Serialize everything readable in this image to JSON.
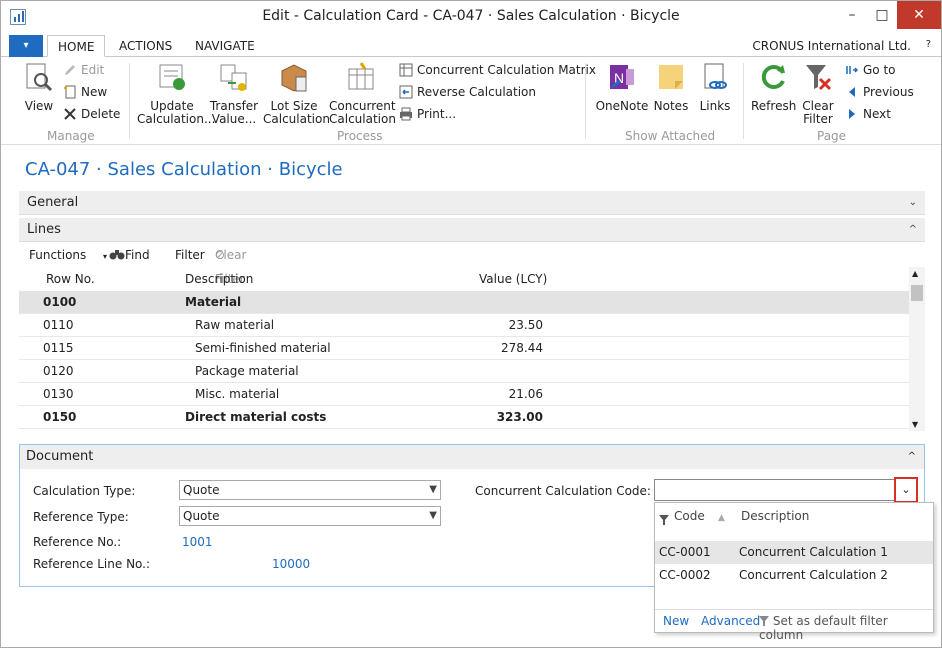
{
  "window": {
    "title": "Edit - Calculation Card - CA-047 · Sales Calculation · Bicycle",
    "minimize": "–",
    "maximize": "□",
    "close": "✕"
  },
  "ribbon_tabs": {
    "menu": "▾",
    "home": "HOME",
    "actions": "ACTIONS",
    "navigate": "NAVIGATE",
    "company": "CRONUS International Ltd.",
    "help": "?"
  },
  "ribbon": {
    "view": "View",
    "edit": "Edit",
    "new": "New",
    "delete": "Delete",
    "update_calculation": [
      "Update",
      "Calculation..."
    ],
    "transfer_value": [
      "Transfer",
      "Value..."
    ],
    "lot_size_calculation": [
      "Lot Size",
      "Calculation"
    ],
    "concurrent_calculation": [
      "Concurrent",
      "Calculation"
    ],
    "concurrent_calculation_matrix": "Concurrent Calculation Matrix",
    "reverse_calculation": "Reverse Calculation",
    "print": "Print...",
    "onenote": "OneNote",
    "notes": "Notes",
    "links": "Links",
    "refresh": "Refresh",
    "clear_filter": [
      "Clear",
      "Filter"
    ],
    "go_to": "Go to",
    "previous": "Previous",
    "next": "Next",
    "groups": {
      "manage": "Manage",
      "process": "Process",
      "show_attached": "Show Attached",
      "page": "Page"
    }
  },
  "page_title": "CA-047 · Sales Calculation · Bicycle",
  "fasttabs": {
    "general": "General",
    "lines": "Lines"
  },
  "lines_toolbar": {
    "functions": "Functions",
    "find": "Find",
    "filter": "Filter",
    "clear_filter": "Clear Filter"
  },
  "lines": {
    "headers": {
      "row_no": "Row No.",
      "description": "Description",
      "value": "Value (LCY)"
    },
    "rows": [
      {
        "row_no": "0100",
        "description": "Material",
        "value": ""
      },
      {
        "row_no": "0110",
        "description": "Raw material",
        "value": "23.50"
      },
      {
        "row_no": "0115",
        "description": "Semi-finished material",
        "value": "278.44"
      },
      {
        "row_no": "0120",
        "description": "Package material",
        "value": ""
      },
      {
        "row_no": "0130",
        "description": "Misc. material",
        "value": "21.06"
      },
      {
        "row_no": "0150",
        "description": "Direct material costs",
        "value": "323.00"
      }
    ]
  },
  "document": {
    "title": "Document",
    "calculation_type_label": "Calculation Type:",
    "calculation_type": "Quote",
    "reference_type_label": "Reference Type:",
    "reference_type": "Quote",
    "reference_no_label": "Reference No.:",
    "reference_no": "1001",
    "reference_line_no_label": "Reference Line No.:",
    "reference_line_no": "10000",
    "concurrent_code_label": "Concurrent Calculation Code:",
    "concurrent_code": ""
  },
  "dropdown": {
    "col_code": "Code",
    "col_description": "Description",
    "rows": [
      {
        "code": "CC-0001",
        "description": "Concurrent Calculation 1"
      },
      {
        "code": "CC-0002",
        "description": "Concurrent Calculation 2"
      }
    ],
    "new": "New",
    "advanced": "Advanced",
    "set_default": "Set as default filter column"
  }
}
